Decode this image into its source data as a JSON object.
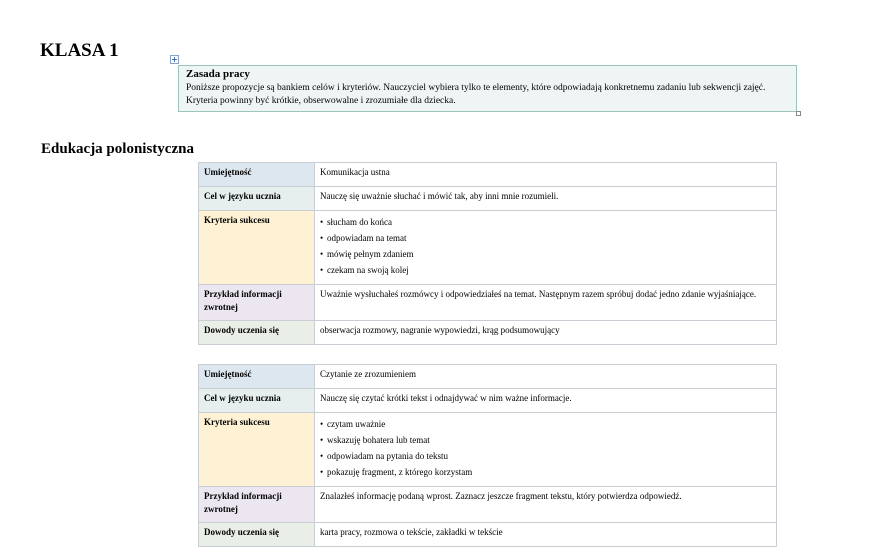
{
  "page": {
    "title": "KLASA 1",
    "section_title": "Edukacja polonistyczna"
  },
  "note": {
    "title": "Zasada pracy",
    "text": "Poniższe propozycje są bankiem celów i kryteriów. Nauczyciel wybiera tylko te elementy, które odpowiadają konkretnemu zadaniu lub sekwencji zajęć. Kryteria powinny być krótkie, obserwowalne i zrozumiałe dla dziecka."
  },
  "labels": {
    "skill": "Umiejętność",
    "goal": "Cel w języku ucznia",
    "criteria": "Kryteria sukcesu",
    "feedback": "Przykład informacji zwrotnej",
    "evidence": "Dowody uczenia się"
  },
  "tables": [
    {
      "skill": "Komunikacja ustna",
      "goal": "Nauczę się uważnie słuchać i mówić tak, aby inni mnie rozumieli.",
      "criteria": [
        "słucham do końca",
        "odpowiadam na temat",
        "mówię pełnym zdaniem",
        "czekam na swoją kolej"
      ],
      "feedback": "Uważnie wysłuchałeś rozmówcy i odpowiedziałeś na temat. Następnym razem spróbuj dodać jedno zdanie wyjaśniające.",
      "evidence": "obserwacja rozmowy, nagranie wypowiedzi, krąg podsumowujący"
    },
    {
      "skill": "Czytanie ze zrozumieniem",
      "goal": "Nauczę się czytać krótki tekst i odnajdywać w nim ważne informacje.",
      "criteria": [
        "czytam uważnie",
        "wskazuję bohatera lub temat",
        "odpowiadam na pytania do tekstu",
        "pokazuję fragment, z którego korzystam"
      ],
      "feedback": "Znalazłeś informację podaną wprost. Zaznacz jeszcze fragment tekstu, który potwierdza odpowiedź.",
      "evidence": "karta pracy, rozmowa o tekście, zakładki w tekście"
    }
  ]
}
